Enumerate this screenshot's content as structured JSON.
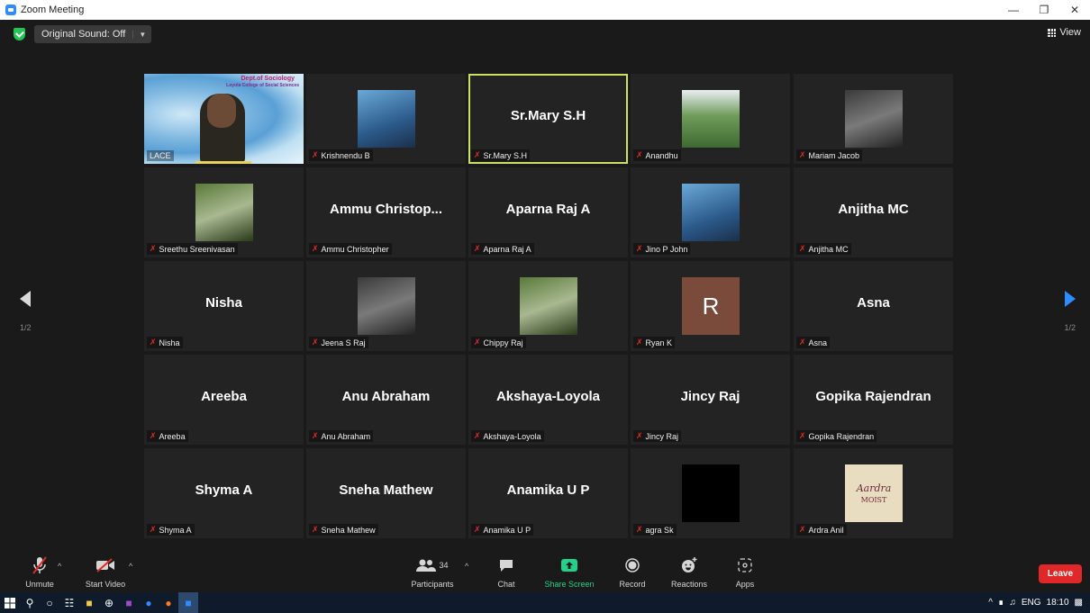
{
  "window": {
    "title": "Zoom Meeting"
  },
  "topbar": {
    "sound_label": "Original Sound: Off",
    "view_label": "View"
  },
  "pagination": {
    "left": "1/2",
    "right": "1/2"
  },
  "tiles": [
    {
      "name": "LACE",
      "big": "",
      "type": "share"
    },
    {
      "name": "Krishnendu B",
      "big": "",
      "type": "photo"
    },
    {
      "name": "Sr.Mary S.H",
      "big": "Sr.Mary S.H",
      "type": "text",
      "active": true
    },
    {
      "name": "Anandhu",
      "big": "",
      "type": "photo"
    },
    {
      "name": "Mariam Jacob",
      "big": "",
      "type": "photo"
    },
    {
      "name": "Sreethu Sreenivasan",
      "big": "",
      "type": "photo"
    },
    {
      "name": "Ammu Christopher",
      "big": "Ammu  Christop...",
      "type": "text"
    },
    {
      "name": "Aparna Raj A",
      "big": "Aparna Raj A",
      "type": "text"
    },
    {
      "name": "Jino P John",
      "big": "",
      "type": "photo"
    },
    {
      "name": "Anjitha MC",
      "big": "Anjitha MC",
      "type": "text"
    },
    {
      "name": "Nisha",
      "big": "Nisha",
      "type": "text"
    },
    {
      "name": "Jeena S Raj",
      "big": "",
      "type": "photo"
    },
    {
      "name": "Chippy Raj",
      "big": "",
      "type": "photo"
    },
    {
      "name": "Ryan K",
      "big": "R",
      "type": "avatar"
    },
    {
      "name": "Asna",
      "big": "Asna",
      "type": "text"
    },
    {
      "name": "Areeba",
      "big": "Areeba",
      "type": "text"
    },
    {
      "name": "Anu Abraham",
      "big": "Anu Abraham",
      "type": "text"
    },
    {
      "name": "Akshaya-Loyola",
      "big": "Akshaya-Loyola",
      "type": "text"
    },
    {
      "name": "Jincy Raj",
      "big": "Jincy Raj",
      "type": "text"
    },
    {
      "name": "Gopika Rajendran",
      "big": "Gopika Rajendran",
      "type": "text"
    },
    {
      "name": "Shyma A",
      "big": "Shyma A",
      "type": "text"
    },
    {
      "name": "Sneha Mathew",
      "big": "Sneha Mathew",
      "type": "text"
    },
    {
      "name": "Anamika U P",
      "big": "Anamika U P",
      "type": "text"
    },
    {
      "name": "agra Sk",
      "big": "",
      "type": "black"
    },
    {
      "name": "Ardra Anil",
      "big": "",
      "type": "logo"
    }
  ],
  "share": {
    "line1": "Dept.of Sociology",
    "line2": "Loyola College of Social Sciences"
  },
  "logo": {
    "line1": "Aardra",
    "line2": "MOIST"
  },
  "toolbar": {
    "unmute": "Unmute",
    "start_video": "Start Video",
    "participants": "Participants",
    "participant_count": "34",
    "chat": "Chat",
    "share_screen": "Share Screen",
    "record": "Record",
    "reactions": "Reactions",
    "apps": "Apps",
    "leave": "Leave"
  },
  "taskbar": {
    "lang": "ENG",
    "time": "18:10"
  },
  "colors": {
    "accent": "#2d8cff",
    "leave": "#e02828",
    "active_border": "#c9e265",
    "share_green": "#23d18b"
  }
}
